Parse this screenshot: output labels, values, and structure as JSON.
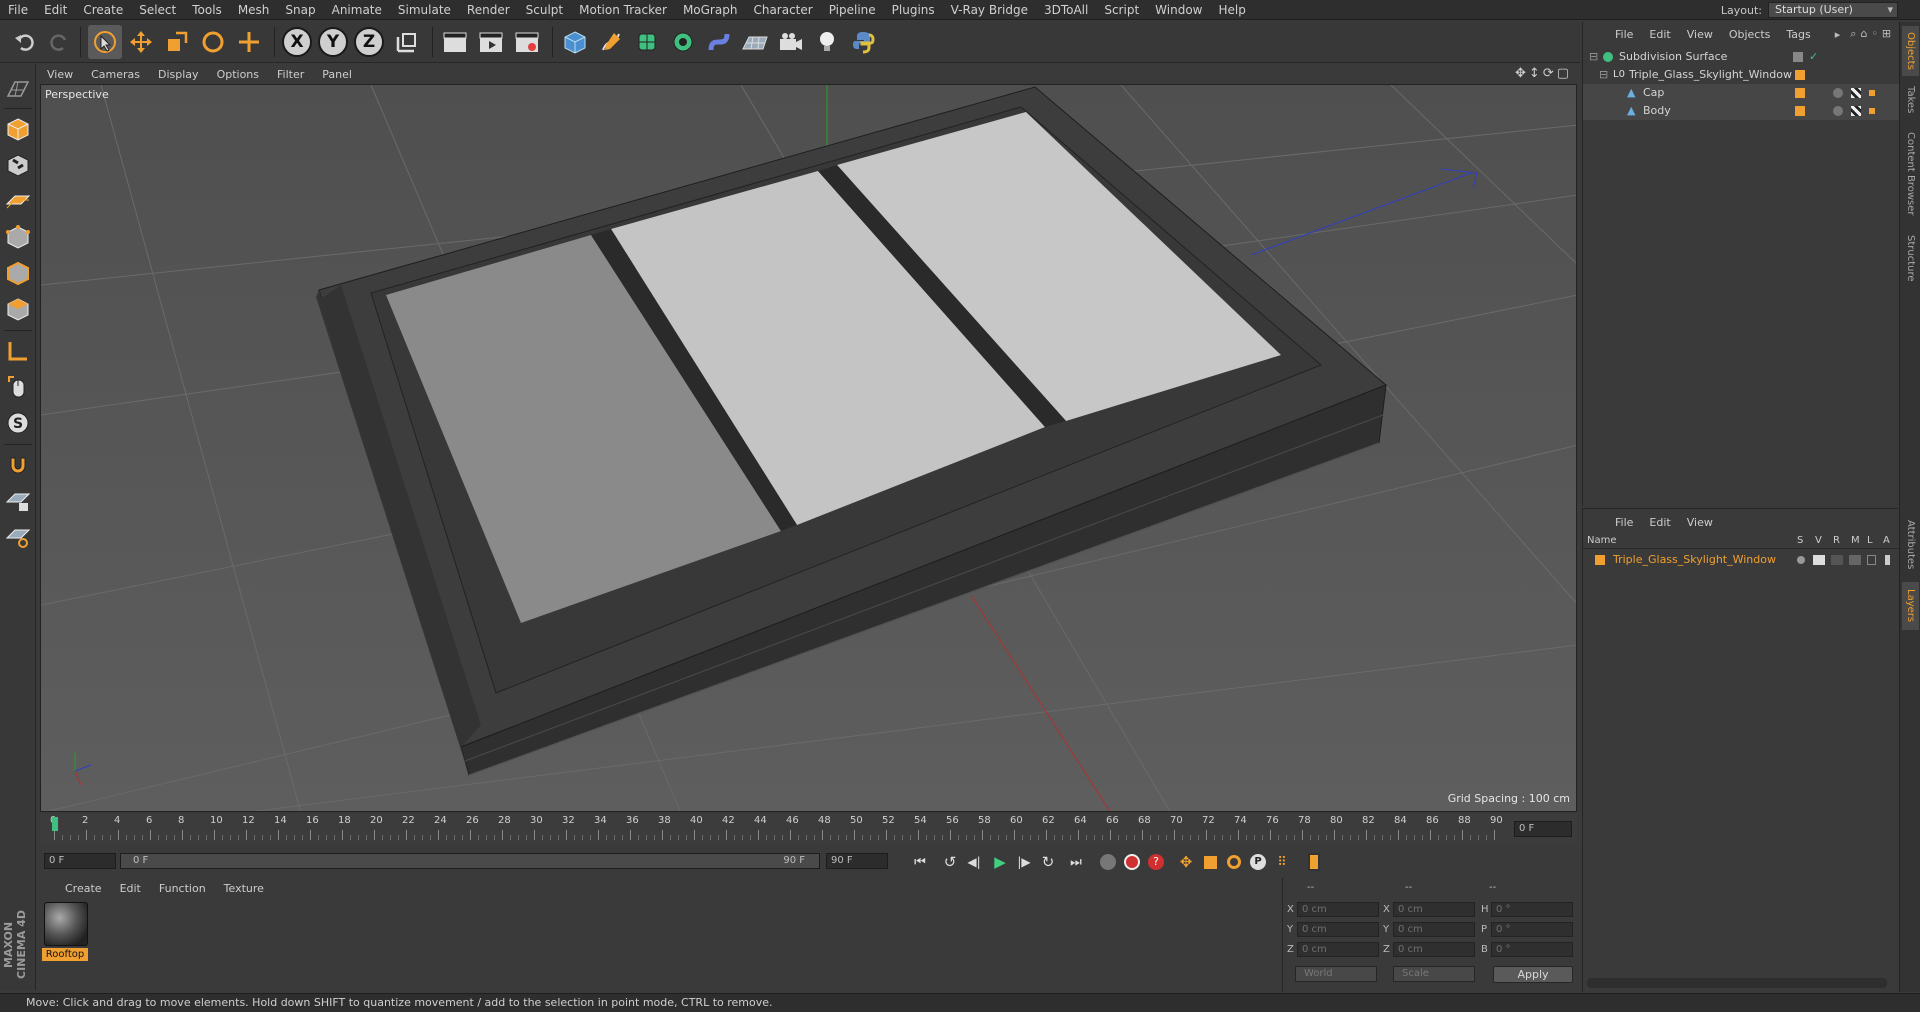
{
  "menu": [
    "File",
    "Edit",
    "Create",
    "Select",
    "Tools",
    "Mesh",
    "Snap",
    "Animate",
    "Simulate",
    "Render",
    "Sculpt",
    "Motion Tracker",
    "MoGraph",
    "Character",
    "Pipeline",
    "Plugins",
    "V-Ray Bridge",
    "3DToAll",
    "Script",
    "Window",
    "Help"
  ],
  "layout": {
    "label": "Layout:",
    "value": "Startup (User)"
  },
  "toolbar": {
    "axis_x": "X",
    "axis_y": "Y",
    "axis_z": "Z"
  },
  "viewport": {
    "menu": [
      "View",
      "Cameras",
      "Display",
      "Options",
      "Filter",
      "Panel"
    ],
    "label": "Perspective",
    "grid_spacing": "Grid Spacing : 100 cm"
  },
  "timeline": {
    "ticks": [
      "0",
      "2",
      "4",
      "6",
      "8",
      "10",
      "12",
      "14",
      "16",
      "18",
      "20",
      "22",
      "24",
      "26",
      "28",
      "30",
      "32",
      "34",
      "36",
      "38",
      "40",
      "42",
      "44",
      "46",
      "48",
      "50",
      "52",
      "54",
      "56",
      "58",
      "60",
      "62",
      "64",
      "66",
      "68",
      "70",
      "72",
      "74",
      "76",
      "78",
      "80",
      "82",
      "84",
      "86",
      "88",
      "90"
    ],
    "current_frame": "0 F",
    "start_field": "0 F",
    "range_start": "0 F",
    "range_end": "90 F",
    "end_field": "90 F"
  },
  "material": {
    "menu": [
      "Create",
      "Edit",
      "Function",
      "Texture"
    ],
    "name": "Rooftop"
  },
  "coords": {
    "header_left": "--",
    "header_mid": "--",
    "header_right": "--",
    "pos": {
      "x": "0 cm",
      "y": "0 cm",
      "z": "0 cm"
    },
    "size": {
      "x": "0 cm",
      "y": "0 cm",
      "z": "0 cm"
    },
    "rot": {
      "h": "0 °",
      "p": "0 °",
      "b": "0 °"
    },
    "mode_world": "World",
    "mode_scale": "Scale",
    "apply": "Apply"
  },
  "objects": {
    "menu": [
      "File",
      "Edit",
      "View",
      "Objects",
      "Tags"
    ],
    "rows": [
      {
        "name": "Subdivision Surface"
      },
      {
        "name": "Triple_Glass_Skylight_Window"
      },
      {
        "name": "Cap"
      },
      {
        "name": "Body"
      }
    ]
  },
  "layers": {
    "menu": [
      "File",
      "Edit",
      "View"
    ],
    "columns": {
      "name": "Name",
      "s": "S",
      "v": "V",
      "r": "R",
      "m": "M",
      "l": "L",
      "a": "A"
    },
    "rows": [
      {
        "name": "Triple_Glass_Skylight_Window",
        "color": "#f0a030"
      }
    ]
  },
  "right_tabs": [
    "Objects",
    "Takes",
    "Content Browser",
    "Structure",
    "Attributes",
    "Layers"
  ],
  "status": "Move: Click and drag to move elements. Hold down SHIFT to quantize movement / add to the selection in point mode, CTRL to remove.",
  "logo": "MAXON CINEMA 4D",
  "colors": {
    "accent": "#f0a030",
    "x_axis": "#c03030",
    "y_axis": "#30a030",
    "z_axis": "#3040c0"
  }
}
